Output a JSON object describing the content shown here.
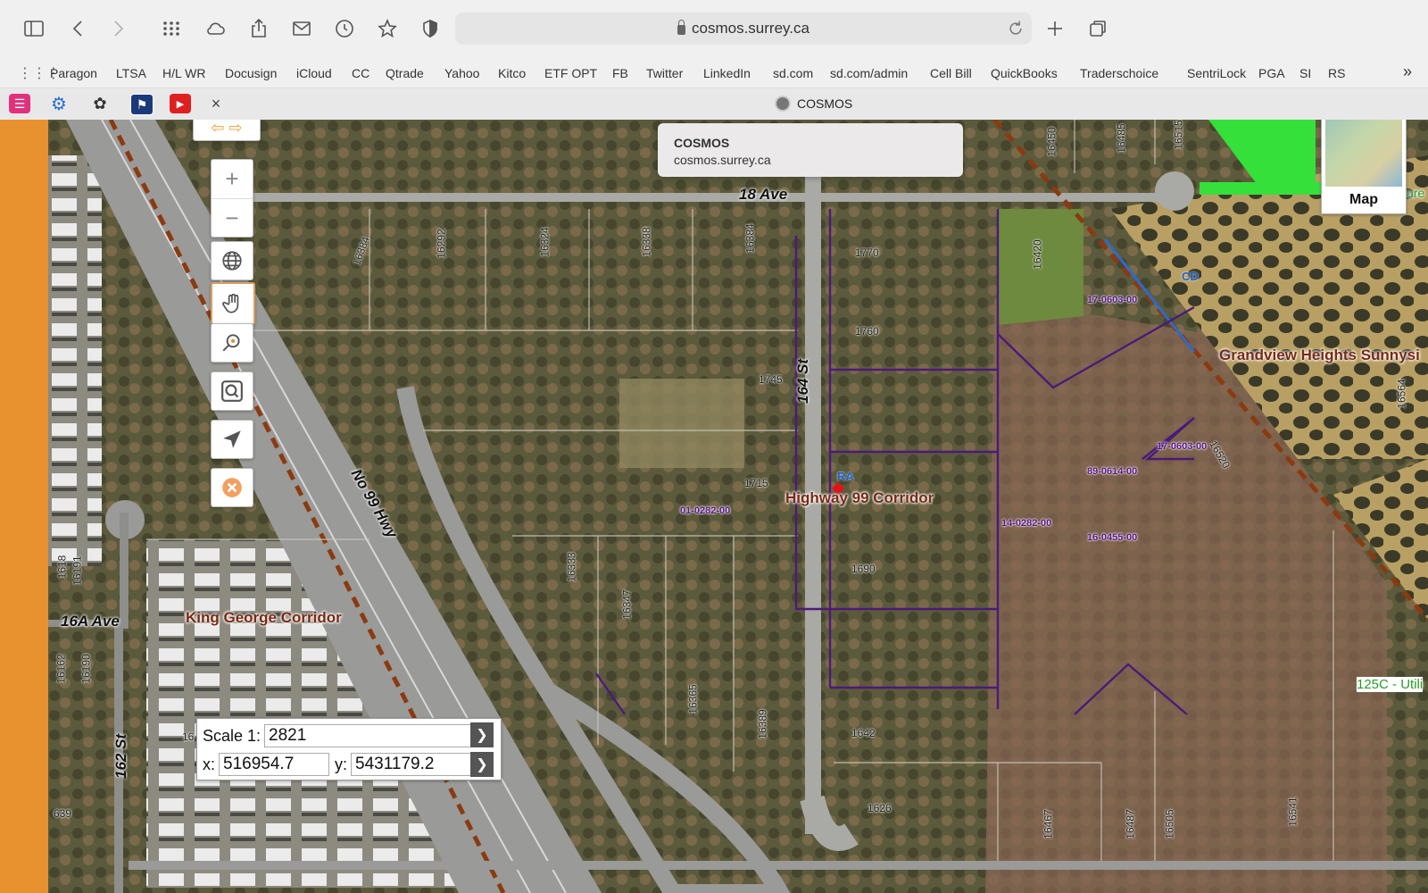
{
  "browser": {
    "url": "cosmos.surrey.ca",
    "bookmarks": [
      "Paragon",
      "LTSA",
      "H/L WR",
      "Docusign",
      "iCloud",
      "CC",
      "Qtrade",
      "Yahoo",
      "Kitco",
      "ETF OPT",
      "FB",
      "Twitter",
      "LinkedIn",
      "sd.com",
      "sd.com/admin",
      "Cell Bill",
      "QuickBooks",
      "Traderschoice",
      "SentriLock",
      "PGA",
      "SI",
      "RS"
    ],
    "tab_title": "COSMOS",
    "tab_close": "×",
    "overflow": "»"
  },
  "tooltip": {
    "title": "COSMOS",
    "url": "cosmos.surrey.ca"
  },
  "map": {
    "roads": {
      "ave18": "18 Ave",
      "st164": "164 St",
      "hwy99": "No 99 Hwy",
      "ave16a": "16A Ave",
      "st162": "162 St"
    },
    "zones": {
      "king_george": "King George Corridor",
      "highway99": "Highway 99 Corridor",
      "grandview": "Grandview Heights Sunnysi",
      "utility": "125C - Utili",
      "ure": "ure"
    },
    "designations": {
      "ra": "RA",
      "cd": "CD"
    },
    "applications": [
      "17-0603-00",
      "17-0603-00",
      "89-0614-00",
      "01-0282-00",
      "14-0282-00",
      "16-0455-00"
    ],
    "addresses": [
      "16384",
      "16292",
      "16324",
      "16338",
      "16384",
      "1770",
      "1760",
      "1745",
      "1715",
      "1690",
      "1642",
      "1626",
      "16333",
      "16347",
      "16365",
      "16389",
      "16420",
      "16450",
      "16485",
      "16515",
      "16520",
      "16467",
      "16487",
      "16505",
      "16541",
      "16191",
      "16190",
      "16162",
      "1618",
      "639",
      "16",
      "16564"
    ]
  },
  "minimap": {
    "label": "Map"
  },
  "scale": {
    "label": "Scale 1:",
    "value": "2821",
    "x_label": "x:",
    "x_value": "516954.7",
    "y_label": "y:",
    "y_value": "5431179.2"
  },
  "icons": {
    "sidebar": "sidebar-icon",
    "back": "back-icon",
    "forward": "forward-icon",
    "grid": "grid-icon",
    "cloud": "cloud-icon",
    "share": "share-icon",
    "mail": "mail-icon",
    "history": "history-icon",
    "star": "star-icon",
    "shield": "shield-icon",
    "reload": "reload-icon",
    "plus": "new-tab-icon",
    "tabs": "tabs-overview-icon"
  },
  "colors": {
    "accent_orange": "#e8912f",
    "application_purple": "#4b1a7a",
    "zone_brown": "#7a2a12",
    "selected_marker": "#e4101b"
  }
}
